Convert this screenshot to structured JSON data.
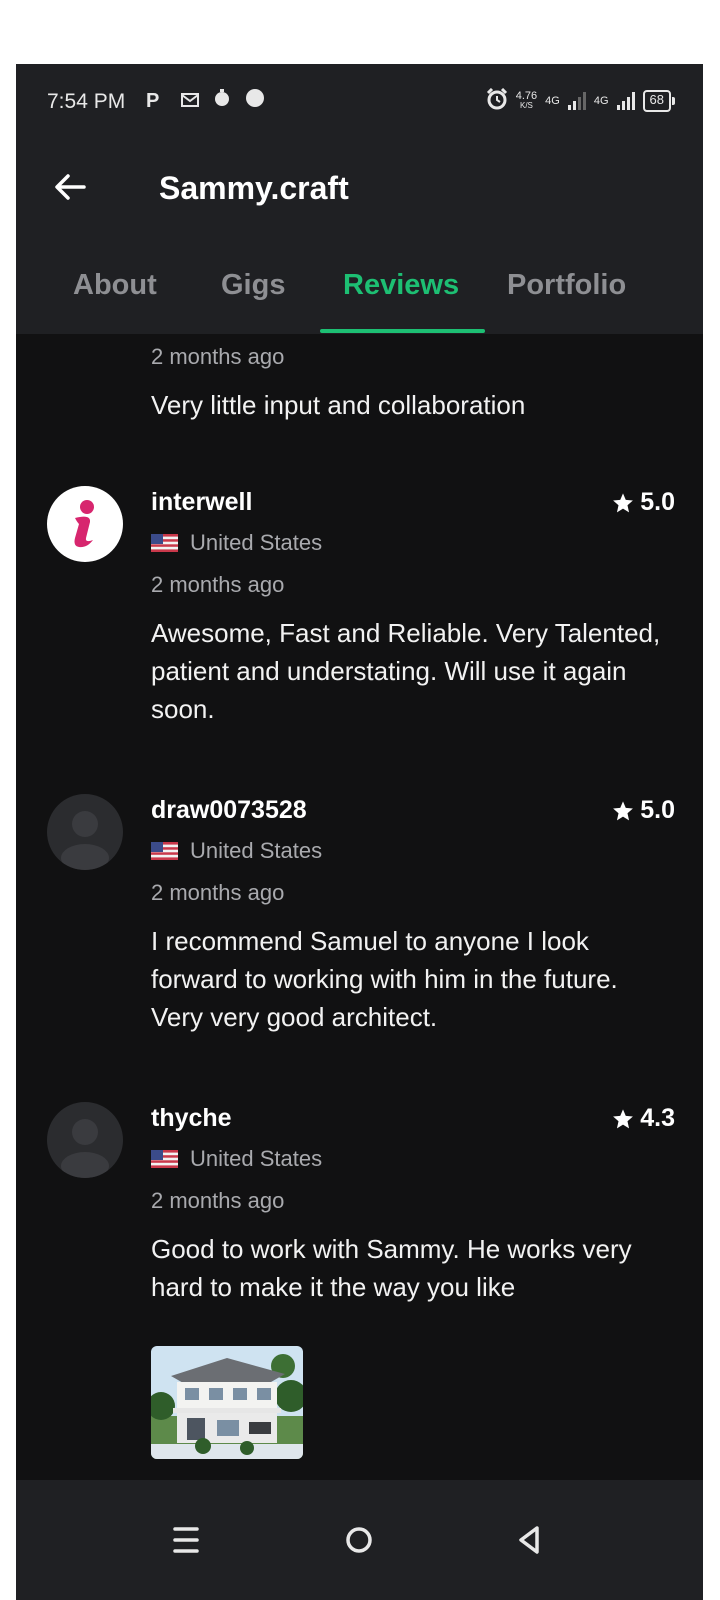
{
  "status_bar": {
    "time": "7:54 PM",
    "notification_icons": [
      "P",
      "M",
      "alarm-clock",
      "dot"
    ],
    "net_speed": "4.76",
    "net_unit": "K/S",
    "sim1": "4G",
    "sim2": "4G",
    "battery": "68"
  },
  "header": {
    "title": "Sammy.craft",
    "back_icon": "arrow-left-icon"
  },
  "tabs": [
    {
      "label": "About",
      "active": false
    },
    {
      "label": "Gigs",
      "active": false
    },
    {
      "label": "Reviews",
      "active": true
    },
    {
      "label": "Portfolio",
      "active": false
    }
  ],
  "partial_review": {
    "time_ago": "2 months ago",
    "text": "Very little input and collaboration"
  },
  "reviews": [
    {
      "username": "interwell",
      "rating": "5.0",
      "country": "United States",
      "time_ago": "2 months ago",
      "text": "Awesome, Fast and Reliable. Very Talented, patient and understating. Will use it again soon.",
      "avatar": "letter-i-logo"
    },
    {
      "username": "draw0073528",
      "rating": "5.0",
      "country": "United States",
      "time_ago": "2 months ago",
      "text": "I recommend Samuel to anyone I look forward to working with him in the future. Very very good architect.",
      "avatar": "default-user-avatar"
    },
    {
      "username": "thyche",
      "rating": "4.3",
      "country": "United States",
      "time_ago": "2 months ago",
      "text": "Good to work with Sammy.  He works very hard to make it the way you like",
      "avatar": "default-user-avatar",
      "attachment": "house-rendering-thumbnail"
    }
  ],
  "nav": {
    "recents": "menu-icon",
    "home": "circle-home-icon",
    "back": "triangle-back-icon"
  },
  "colors": {
    "accent": "#1dbf73",
    "background": "#111112",
    "bar": "#1f2023",
    "brand_i": "#d7266e"
  }
}
